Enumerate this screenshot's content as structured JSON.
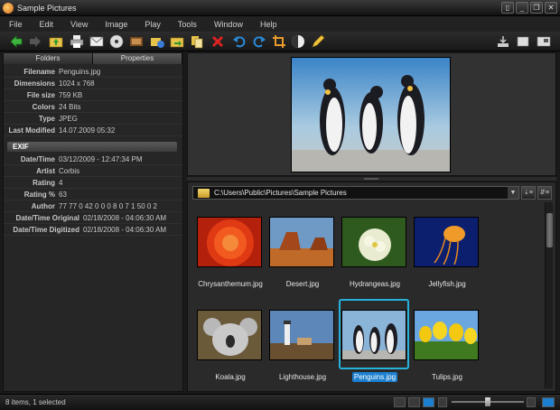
{
  "window": {
    "title": "Sample Pictures",
    "controls": [
      "▯",
      "_",
      "❐",
      "✕"
    ]
  },
  "menu": [
    "File",
    "Edit",
    "View",
    "Image",
    "Play",
    "Tools",
    "Window",
    "Help"
  ],
  "toolbar": {
    "icons": [
      "back-arrow-icon",
      "forward-arrow-icon",
      "folder-up-icon",
      "print-icon",
      "email-icon",
      "cd-burn-icon",
      "slideshow-icon",
      "folder-move-icon",
      "folder-copy-icon",
      "copy-icon",
      "delete-icon",
      "rotate-left-icon",
      "rotate-right-icon",
      "crop-icon",
      "color-adjust-icon",
      "edit-pencil-icon"
    ],
    "right_icons": [
      "import-icon",
      "panel-icon",
      "fullscreen-icon"
    ]
  },
  "left_panel": {
    "tabs": [
      "Folders",
      "Properties"
    ],
    "active_tab": "Properties",
    "properties": [
      {
        "key": "Filename",
        "value": "Penguins.jpg"
      },
      {
        "key": "Dimensions",
        "value": "1024 x 768"
      },
      {
        "key": "File size",
        "value": "759 KB"
      },
      {
        "key": "Colors",
        "value": "24 Bits"
      },
      {
        "key": "Type",
        "value": "JPEG"
      },
      {
        "key": "Last Modified",
        "value": "14.07.2009 05:32"
      }
    ],
    "exif_title": "EXIF",
    "exif": [
      {
        "key": "Date/Time",
        "value": "03/12/2009 - 12:47:34 PM"
      },
      {
        "key": "Artist",
        "value": "Corbis"
      },
      {
        "key": "Rating",
        "value": "4"
      },
      {
        "key": "Rating %",
        "value": "63"
      },
      {
        "key": "Author",
        "value": "77 77 0 42 0 0 0 8 0 7 1 50 0 2"
      },
      {
        "key": "Date/Time Original",
        "value": "02/18/2008 - 04:06:30 AM"
      },
      {
        "key": "Date/Time Digitized",
        "value": "02/18/2008 - 04:06:30 AM"
      }
    ]
  },
  "browser": {
    "path": "C:\\Users\\Public\\Pictures\\Sample Pictures",
    "dropdown_glyph": "▼",
    "sort_glyph": "⇣≡",
    "view_glyph": "⇵≡",
    "thumbnails": [
      {
        "name": "Chrysanthemum.jpg",
        "selected": false
      },
      {
        "name": "Desert.jpg",
        "selected": false
      },
      {
        "name": "Hydrangeas.jpg",
        "selected": false
      },
      {
        "name": "Jellyfish.jpg",
        "selected": false
      },
      {
        "name": "Koala.jpg",
        "selected": false
      },
      {
        "name": "Lighthouse.jpg",
        "selected": false
      },
      {
        "name": "Penguins.jpg",
        "selected": true
      },
      {
        "name": "Tulips.jpg",
        "selected": false
      }
    ]
  },
  "status": {
    "text": "8 items, 1 selected",
    "zoom_level": 0.5
  },
  "colors": {
    "selection": "#27b2dc",
    "selection_label": "#1c7fcf"
  }
}
